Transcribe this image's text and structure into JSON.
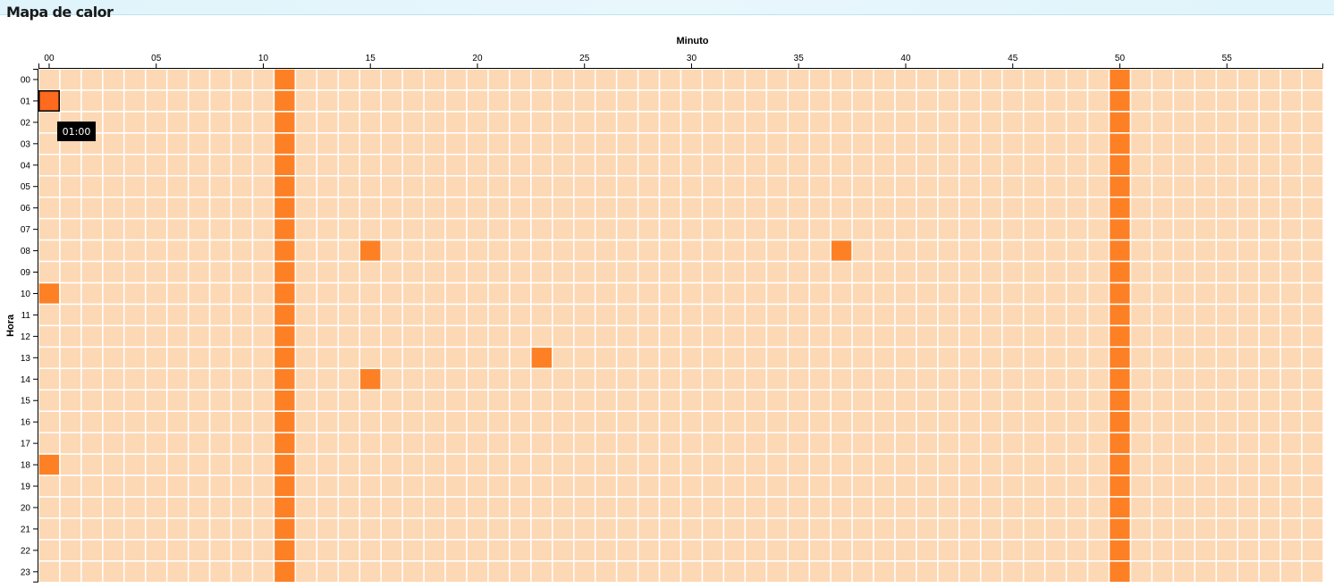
{
  "header": {
    "title": "Mapa de calor"
  },
  "tooltip": {
    "text": "01:00"
  },
  "colors": {
    "low": "#fdd8b4",
    "high": "#fe8024",
    "grid_line": "#ffffff",
    "hover_stroke": "#000000"
  },
  "chart_data": {
    "type": "heatmap",
    "title": "Mapa de calor",
    "xlabel": "Minuto",
    "ylabel": "Hora",
    "x": [
      "00",
      "01",
      "02",
      "03",
      "04",
      "05",
      "06",
      "07",
      "08",
      "09",
      "10",
      "11",
      "12",
      "13",
      "14",
      "15",
      "16",
      "17",
      "18",
      "19",
      "20",
      "21",
      "22",
      "23",
      "24",
      "25",
      "26",
      "27",
      "28",
      "29",
      "30",
      "31",
      "32",
      "33",
      "34",
      "35",
      "36",
      "37",
      "38",
      "39",
      "40",
      "41",
      "42",
      "43",
      "44",
      "45",
      "46",
      "47",
      "48",
      "49",
      "50",
      "51",
      "52",
      "53",
      "54",
      "55",
      "56",
      "57",
      "58",
      "59"
    ],
    "y": [
      "00",
      "01",
      "02",
      "03",
      "04",
      "05",
      "06",
      "07",
      "08",
      "09",
      "10",
      "11",
      "12",
      "13",
      "14",
      "15",
      "16",
      "17",
      "18",
      "19",
      "20",
      "21",
      "22",
      "23"
    ],
    "x_ticks": [
      "00",
      "05",
      "10",
      "15",
      "20",
      "25",
      "30",
      "35",
      "40",
      "45",
      "50",
      "55"
    ],
    "value_levels": [
      "low",
      "high"
    ],
    "high_cells": {
      "all_hours_minutes": [
        "11",
        "50"
      ],
      "points": [
        {
          "hora": "01",
          "minuto": "00"
        },
        {
          "hora": "08",
          "minuto": "15"
        },
        {
          "hora": "08",
          "minuto": "37"
        },
        {
          "hora": "10",
          "minuto": "00"
        },
        {
          "hora": "13",
          "minuto": "23"
        },
        {
          "hora": "14",
          "minuto": "15"
        },
        {
          "hora": "18",
          "minuto": "00"
        }
      ]
    },
    "highlighted_cell": {
      "hora": "01",
      "minuto": "00"
    }
  }
}
